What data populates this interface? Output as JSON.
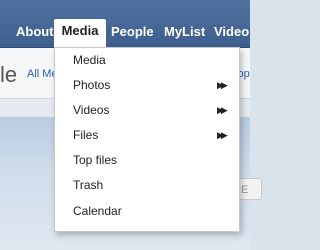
{
  "navbar": {
    "items": [
      {
        "label": "About"
      },
      {
        "label": "Media"
      },
      {
        "label": "People"
      },
      {
        "label": "MyList"
      },
      {
        "label": "Video"
      }
    ]
  },
  "page": {
    "title_fragment": "le",
    "filter_link": "All Me",
    "right_link": "Top",
    "input_fragment": "E"
  },
  "dropdown": {
    "items": [
      {
        "label": "Media",
        "submenu_icon": ""
      },
      {
        "label": "Photos",
        "submenu_icon": "▶▶"
      },
      {
        "label": "Videos",
        "submenu_icon": "▶▶"
      },
      {
        "label": "Files",
        "submenu_icon": "▶▶"
      },
      {
        "label": "Top files",
        "submenu_icon": ""
      },
      {
        "label": "Trash",
        "submenu_icon": ""
      },
      {
        "label": "Calendar",
        "submenu_icon": ""
      }
    ]
  }
}
